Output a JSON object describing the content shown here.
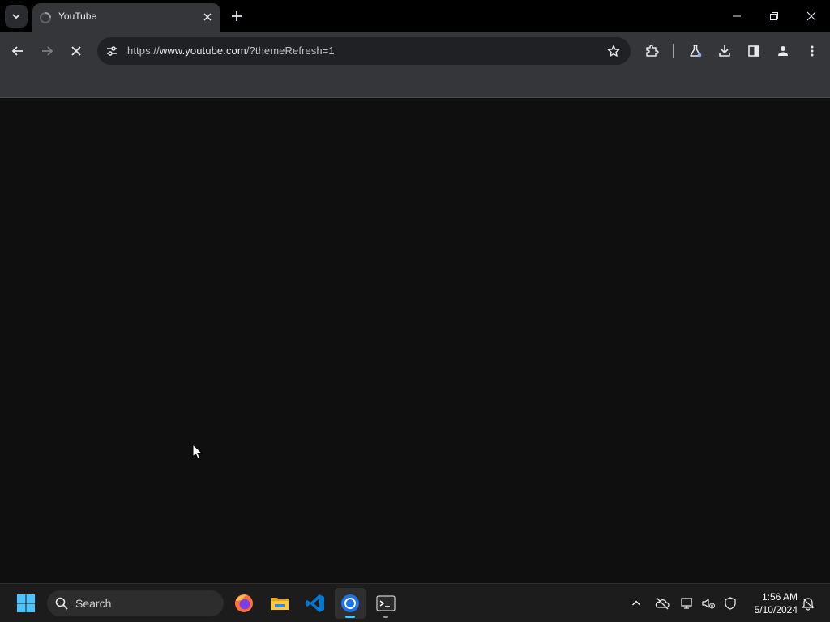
{
  "browser": {
    "tab": {
      "title": "YouTube",
      "favicon": "loading-icon"
    },
    "omnibox": {
      "url_prefix": "https://",
      "url_host": "www.youtube.com",
      "url_rest": "/?themeRefresh=1"
    },
    "icons": {
      "tab_search": "chevron-down-icon",
      "new_tab": "plus-icon",
      "minimize": "minimize-icon",
      "restore": "restore-icon",
      "close": "close-icon",
      "back": "arrow-left-icon",
      "forward": "arrow-right-icon",
      "stop": "close-icon",
      "site_info": "tune-icon",
      "bookmark": "star-icon",
      "extensions": "puzzle-icon",
      "labs": "flask-icon",
      "downloads": "download-icon",
      "side_panel": "side-panel-icon",
      "profile": "person-icon",
      "menu": "more-vertical-icon"
    }
  },
  "taskbar": {
    "search_label": "Search",
    "apps": [
      {
        "name": "Firefox",
        "icon": "firefox-icon"
      },
      {
        "name": "File Explorer",
        "icon": "folder-icon"
      },
      {
        "name": "Visual Studio Code",
        "icon": "vscode-icon"
      },
      {
        "name": "Chrome",
        "icon": "chrome-icon",
        "active": true
      },
      {
        "name": "Terminal",
        "icon": "terminal-icon"
      }
    ],
    "clock": {
      "time": "1:56 AM",
      "date": "5/10/2024"
    }
  },
  "colors": {
    "page_background": "#0f0f0f",
    "toolbar": "#35363a",
    "tabstrip": "#000000",
    "taskbar": "#1c1c1c",
    "accent": "#4cc2ff"
  }
}
